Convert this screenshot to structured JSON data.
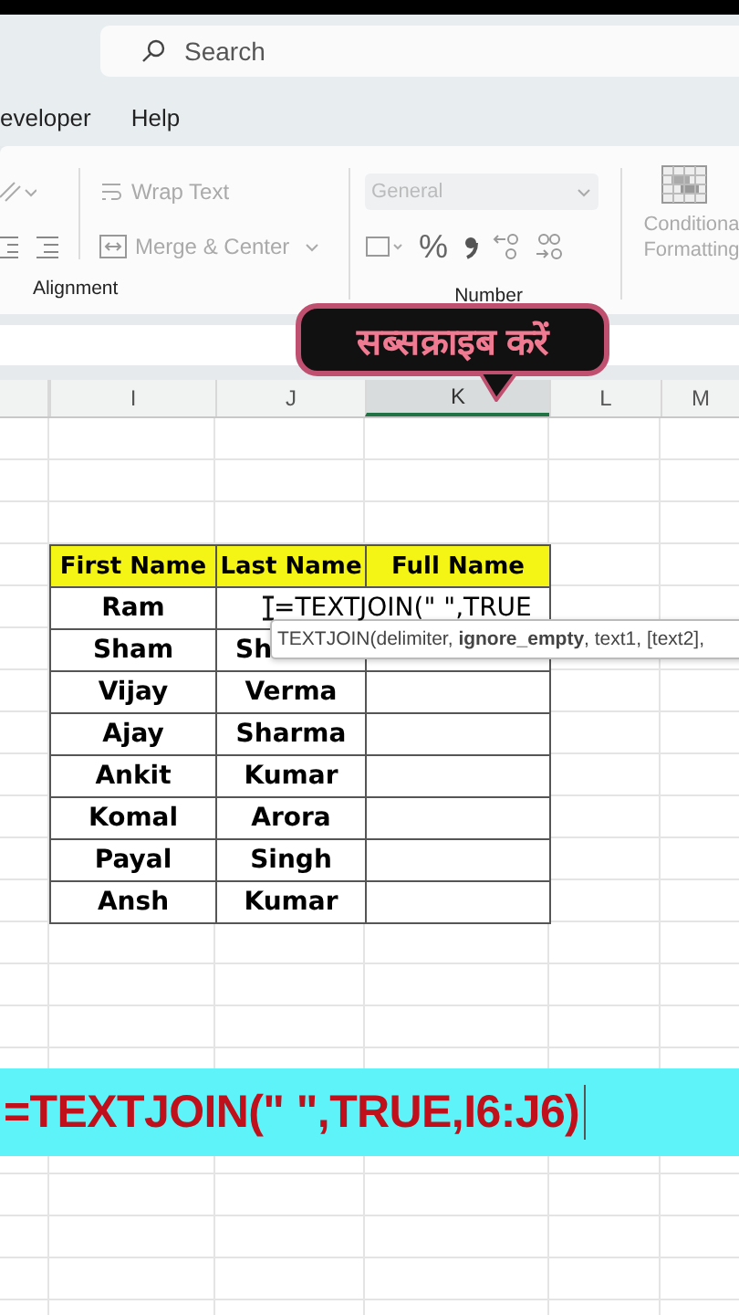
{
  "search": {
    "placeholder": "Search"
  },
  "menu_tabs": [
    "eveloper",
    "Help"
  ],
  "ribbon": {
    "alignment": {
      "label": "Alignment",
      "wrap_text": "Wrap Text",
      "merge_center": "Merge & Center"
    },
    "number": {
      "label": "Number",
      "format": {
        "value": "General",
        "disabled": true
      },
      "percent": "%"
    },
    "conditional_formatting": [
      "Conditiona",
      "Formatting"
    ]
  },
  "sticker": {
    "text": "सब्सक्राइब करें"
  },
  "column_headers": [
    {
      "label": "I",
      "selected": false
    },
    {
      "label": "J",
      "selected": false
    },
    {
      "label": "K",
      "selected": true
    },
    {
      "label": "L",
      "selected": false
    },
    {
      "label": "M",
      "selected": false
    }
  ],
  "table": {
    "columns": [
      "First Name",
      "Last Name",
      "Full Name"
    ],
    "rows": [
      {
        "kind": "editing",
        "first_name": "Ram",
        "formula": "=TEXTJOIN(\" \",TRUE"
      },
      {
        "kind": "covered",
        "first_name": "Sham",
        "last_name": "Sh"
      },
      {
        "kind": "plain",
        "first_name": "Vijay",
        "last_name": "Verma"
      },
      {
        "kind": "plain",
        "first_name": "Ajay",
        "last_name": "Sharma"
      },
      {
        "kind": "plain",
        "first_name": "Ankit",
        "last_name": "Kumar"
      },
      {
        "kind": "plain",
        "first_name": "Komal",
        "last_name": "Arora"
      },
      {
        "kind": "plain",
        "first_name": "Payal",
        "last_name": "Singh"
      },
      {
        "kind": "plain",
        "first_name": "Ansh",
        "last_name": "Kumar"
      }
    ]
  },
  "tooltip": "TEXTJOIN(delimiter, **ignore_empty**, text1, [text2],",
  "banner": {
    "text": "=TEXTJOIN(\" \",TRUE,I6:J6)"
  }
}
